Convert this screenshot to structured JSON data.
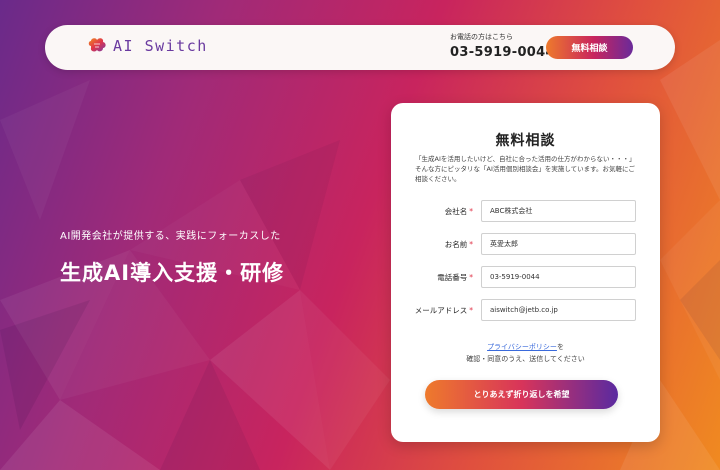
{
  "header": {
    "logo_text": "AI Switch",
    "logo_icon": "brain-icon",
    "phone_caption": "お電話の方はこちら",
    "phone_number": "03-5919-0044",
    "cta_label": "無料相談"
  },
  "hero": {
    "subtitle": "AI開発会社が提供する、実践にフォーカスした",
    "title": "生成AI導入支援・研修"
  },
  "form": {
    "title": "無料相談",
    "description": "「生成AIを活用したいけど、自社に合った活用の仕方がわからない・・・」そんな方にピッタリな「AI活用個別相談会」を実施しています。お気軽にご相談ください。",
    "required_mark": "*",
    "fields": [
      {
        "label": "会社名",
        "value": "ABC株式会社"
      },
      {
        "label": "お名前",
        "value": "英愛太郎"
      },
      {
        "label": "電話番号",
        "value": "03-5919-0044"
      },
      {
        "label": "メールアドレス",
        "value": "aiswitch@jetb.co.jp"
      }
    ],
    "privacy_link": "プライバシーポリシー",
    "privacy_suffix": "を",
    "privacy_note": "確認・同意のうえ、送信してください",
    "submit_label": "とりあえず折り返しを希望"
  },
  "colors": {
    "accent_orange": "#ee7a2c",
    "accent_magenta": "#c8245e",
    "accent_purple": "#6a2a9a",
    "required": "#e0354a",
    "link": "#3a6adb"
  }
}
